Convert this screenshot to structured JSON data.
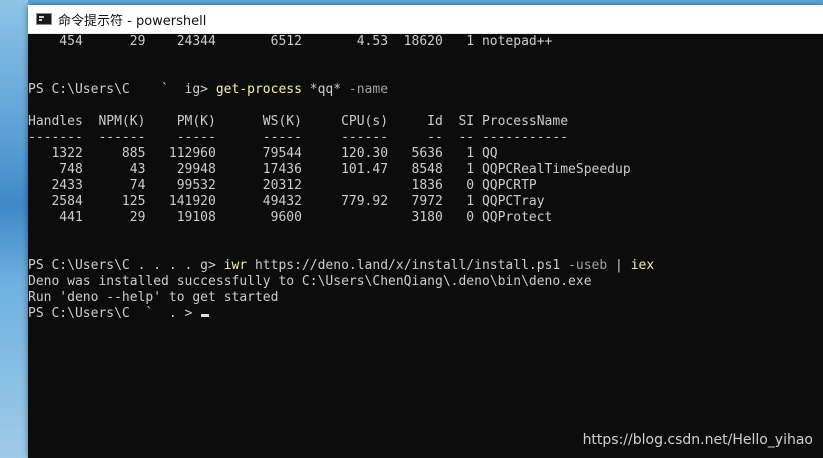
{
  "window": {
    "title": "命令提示符 - powershell"
  },
  "console": {
    "lines": [
      {
        "text": "    454      29    24344       6512       4.53  18620   1 notepad++"
      },
      {
        "text": ""
      },
      {
        "text": ""
      },
      {
        "prompt": "PS C:\\Users\\C    `  ig> ",
        "cmd": "get-process",
        "param": " -name",
        "rest": " *qq*"
      },
      {
        "text": ""
      },
      {
        "text": "Handles  NPM(K)    PM(K)      WS(K)     CPU(s)     Id  SI ProcessName"
      },
      {
        "text": "-------  ------    -----      -----     ------     --  -- -----------"
      },
      {
        "text": "   1322     885   112960      79544     120.30   5636   1 QQ"
      },
      {
        "text": "    748      43    29948      17436     101.47   8548   1 QQPCRealTimeSpeedup"
      },
      {
        "text": "   2433      74    99532      20312              1836   0 QQPCRTP"
      },
      {
        "text": "   2584     125   141920      49432     779.92   7972   1 QQPCTray"
      },
      {
        "text": "    441      29    19108       9600              3180   0 QQProtect"
      },
      {
        "text": ""
      },
      {
        "text": ""
      },
      {
        "prompt": "PS C:\\Users\\C . . . . g> ",
        "cmd": "iwr",
        "rest": " https://deno.land/x/install/install.ps1",
        "param": " -useb",
        "rest2": " | ",
        "cmd2": "iex"
      },
      {
        "text": "Deno was installed successfully to C:\\Users\\ChenQiang\\.deno\\bin\\deno.exe"
      },
      {
        "text": "Run 'deno --help' to get started"
      },
      {
        "prompt": "PS C:\\Users\\C  `  . > ",
        "cursor": true
      }
    ]
  },
  "watermark": "https://blog.csdn.net/Hello_yihao"
}
